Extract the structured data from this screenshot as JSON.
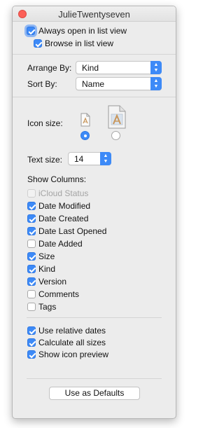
{
  "window": {
    "title": "JulieTwentyseven"
  },
  "top_options": {
    "always_open_list_view": {
      "label": "Always open in list view",
      "checked": true
    },
    "browse_list_view": {
      "label": "Browse in list view",
      "checked": true
    }
  },
  "arrange": {
    "label": "Arrange By:",
    "value": "Kind"
  },
  "sort": {
    "label": "Sort By:",
    "value": "Name"
  },
  "icon_size": {
    "label": "Icon size:",
    "selected": "small"
  },
  "text_size": {
    "label": "Text size:",
    "value": "14"
  },
  "columns": {
    "heading": "Show Columns:",
    "items": [
      {
        "label": "iCloud Status",
        "checked": false,
        "enabled": false
      },
      {
        "label": "Date Modified",
        "checked": true,
        "enabled": true
      },
      {
        "label": "Date Created",
        "checked": true,
        "enabled": true
      },
      {
        "label": "Date Last Opened",
        "checked": true,
        "enabled": true
      },
      {
        "label": "Date Added",
        "checked": false,
        "enabled": true
      },
      {
        "label": "Size",
        "checked": true,
        "enabled": true
      },
      {
        "label": "Kind",
        "checked": true,
        "enabled": true
      },
      {
        "label": "Version",
        "checked": true,
        "enabled": true
      },
      {
        "label": "Comments",
        "checked": false,
        "enabled": true
      },
      {
        "label": "Tags",
        "checked": false,
        "enabled": true
      }
    ]
  },
  "options": [
    {
      "label": "Use relative dates",
      "checked": true
    },
    {
      "label": "Calculate all sizes",
      "checked": true
    },
    {
      "label": "Show icon preview",
      "checked": true
    }
  ],
  "defaults_button": {
    "label": "Use as Defaults"
  },
  "colors": {
    "accent": "#3d8af7",
    "close": "#fc5f57"
  }
}
